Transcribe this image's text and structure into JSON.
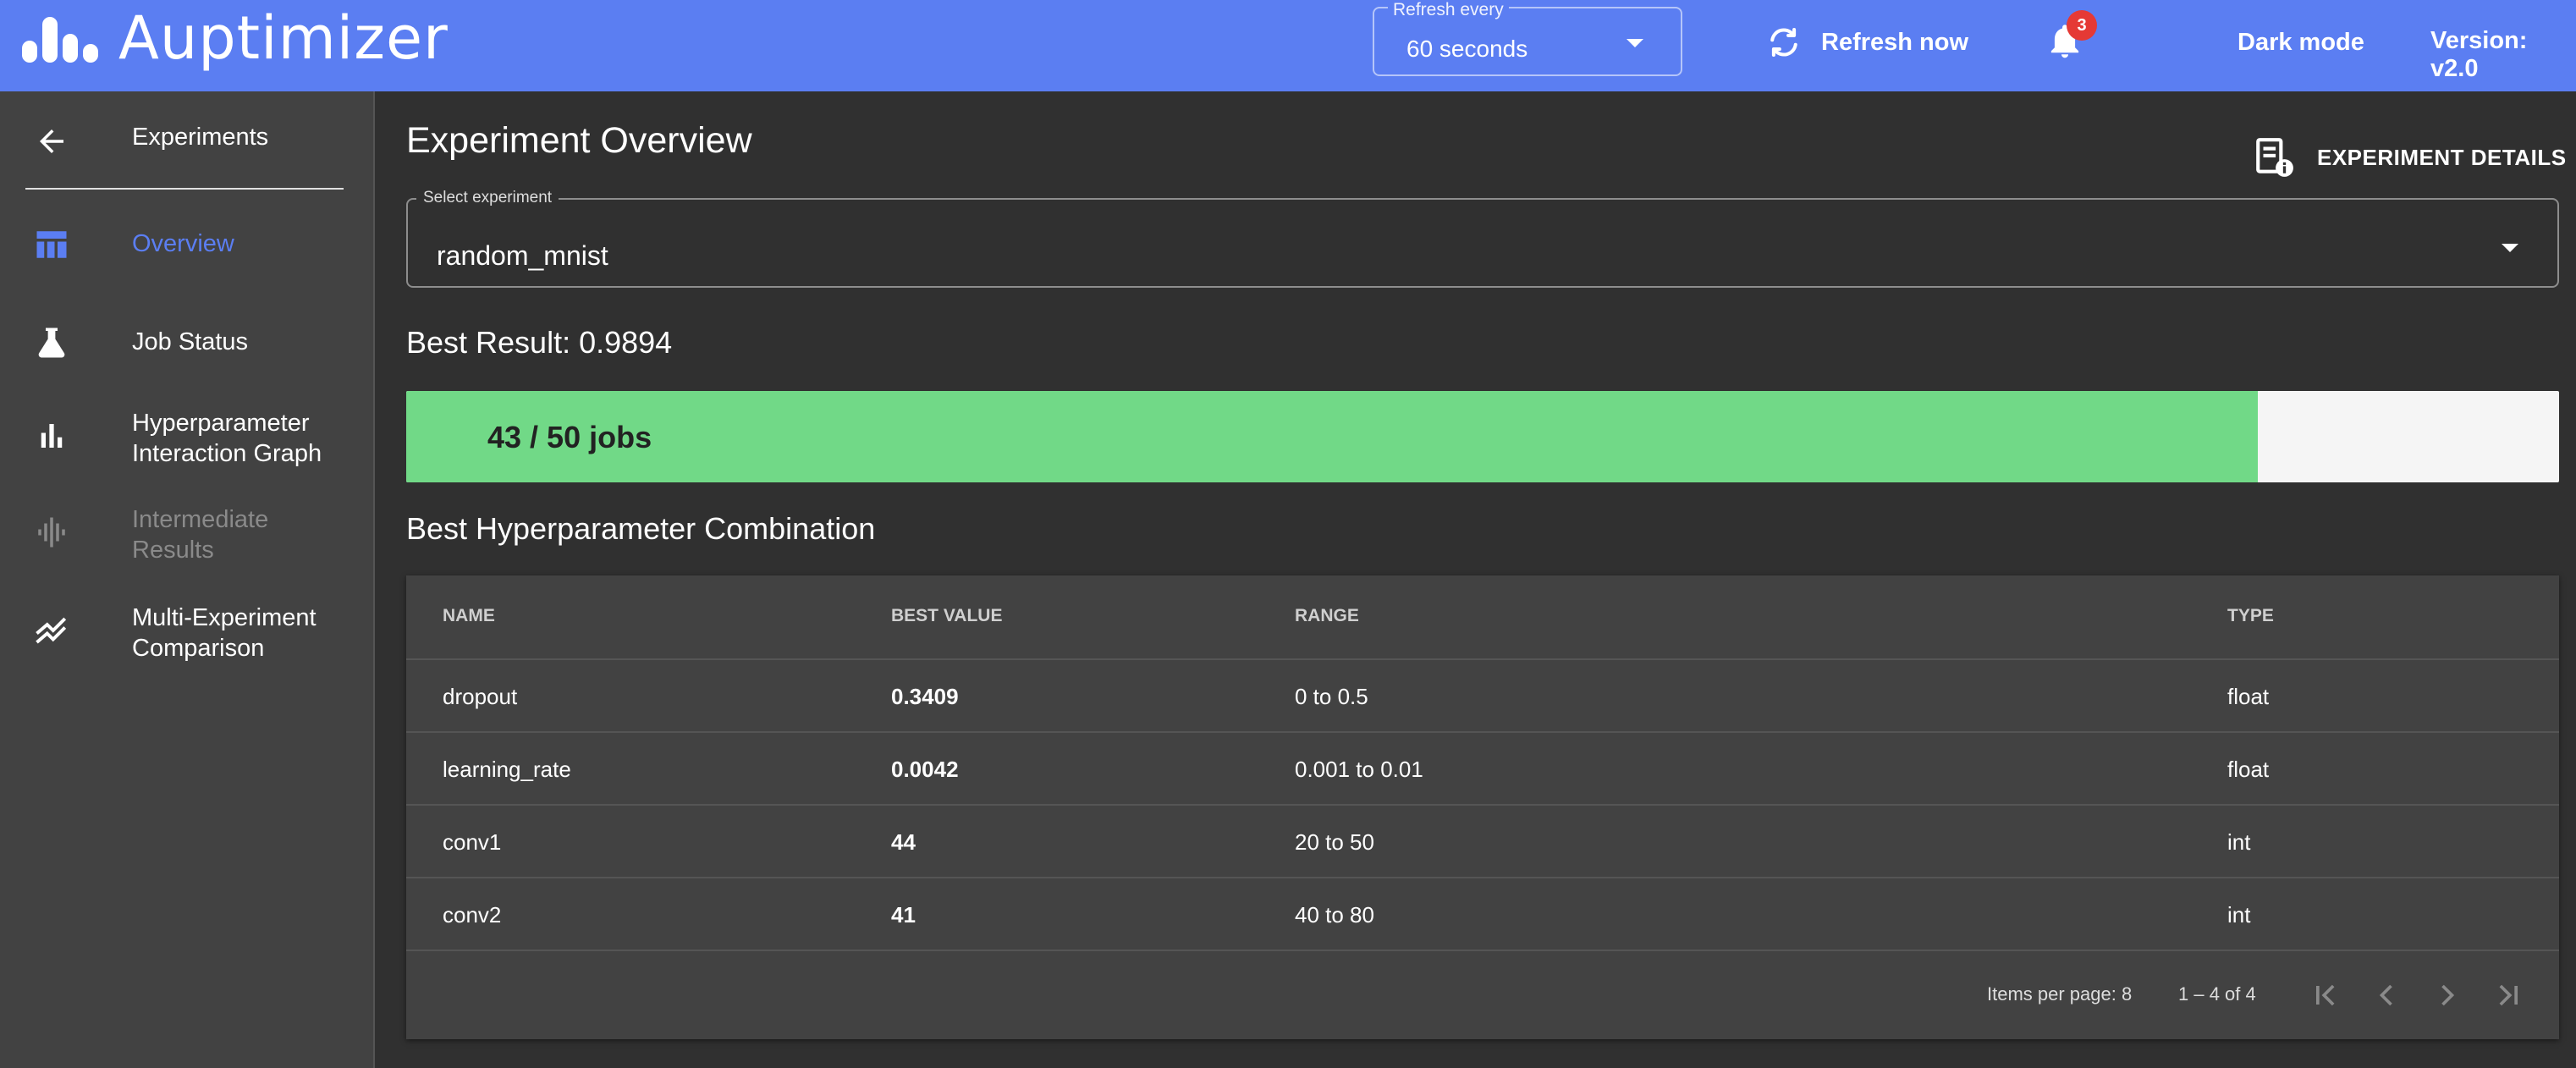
{
  "header": {
    "app_title": "Auptimizer",
    "refresh": {
      "legend": "Refresh every",
      "value": "60 seconds"
    },
    "refresh_now_label": "Refresh now",
    "notification_count": "3",
    "dark_mode_label": "Dark mode",
    "version": "Version: v2.0"
  },
  "sidebar": {
    "back_label": "Experiments",
    "items": [
      {
        "label": "Overview",
        "icon": "table-icon",
        "state": "active"
      },
      {
        "label": "Job Status",
        "icon": "flask-icon",
        "state": "normal"
      },
      {
        "label": "Hyperparameter Interaction Graph",
        "icon": "bar-chart-icon",
        "state": "normal"
      },
      {
        "label": "Intermediate Results",
        "icon": "waveform-icon",
        "state": "disabled"
      },
      {
        "label": "Multi-Experiment Comparison",
        "icon": "multiline-chart-icon",
        "state": "normal"
      }
    ]
  },
  "main": {
    "page_title": "Experiment Overview",
    "details_label": "EXPERIMENT DETAILS",
    "select": {
      "legend": "Select experiment",
      "value": "random_mnist"
    },
    "best_result": "Best Result: 0.9894",
    "progress": {
      "label": "43 / 50 jobs",
      "fraction": 0.86
    },
    "section_title": "Best Hyperparameter Combination",
    "table": {
      "headers": [
        "NAME",
        "BEST VALUE",
        "RANGE",
        "TYPE"
      ],
      "rows": [
        [
          "dropout",
          "0.3409",
          "0 to 0.5",
          "float"
        ],
        [
          "learning_rate",
          "0.0042",
          "0.001 to 0.01",
          "float"
        ],
        [
          "conv1",
          "44",
          "20 to 50",
          "int"
        ],
        [
          "conv2",
          "41",
          "40 to 80",
          "int"
        ]
      ]
    },
    "paginator": {
      "items_per_page": "Items per page: 8",
      "range": "1 – 4 of 4"
    }
  },
  "colors": {
    "topbar": "#5b7ef2",
    "sidebar": "#424242",
    "background": "#303030",
    "progress_fill": "#71d987",
    "badge": "#e53935"
  }
}
